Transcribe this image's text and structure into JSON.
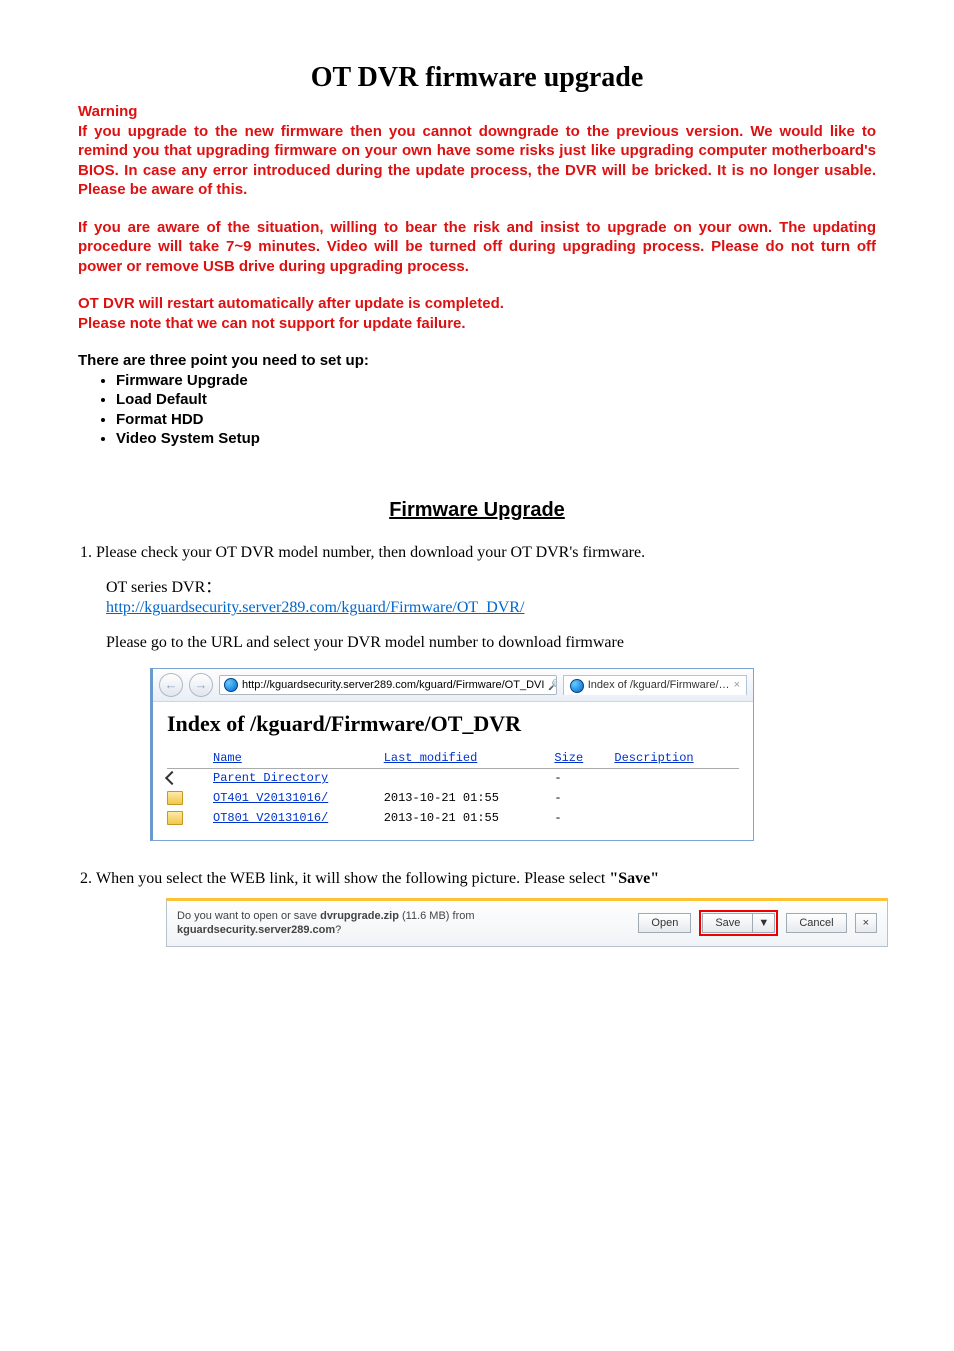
{
  "doc": {
    "title": "OT DVR firmware upgrade",
    "warning_label": "Warning",
    "warn_p1": "If you upgrade to the new firmware then you cannot downgrade to the previous version. We would like to remind you that upgrading firmware on your own have some risks just like upgrading computer motherboard's BIOS. In case any error introduced during the update process, the DVR will be bricked. It is no longer usable. Please be aware of this.",
    "warn_p2": "If you are aware of the situation, willing to bear the risk and insist to upgrade on your own. The updating procedure will take 7~9 minutes. Video will be turned off during upgrading process. Please do not turn off power or remove USB drive during upgrading process.",
    "warn_p3a": "OT DVR will restart automatically after update is completed.",
    "warn_p3b": "Please note that we can not support for update failure.",
    "setup_head": "There are three point you need to set up:",
    "setup_items": [
      "Firmware Upgrade",
      "Load Default",
      "Format HDD",
      "Video System Setup"
    ],
    "section_heading": "Firmware Upgrade",
    "step1": "Please check your OT DVR model number, then download your OT DVR's firmware.",
    "step1_label": "OT series DVR：",
    "step1_url": "http://kguardsecurity.server289.com/kguard/Firmware/OT_DVR/",
    "step1_note": "Please go to the URL and select your DVR model number to download firmware",
    "step2_pre": "When you select the WEB link, it will show the following picture. Please select ",
    "step2_bold": "\"Save\""
  },
  "browser": {
    "address": "http://kguardsecurity.server289.com/kguard/Firmware/OT_DVI",
    "search_glyph": "🔎",
    "tab_title": "Index of /kguard/Firmware/…",
    "page_heading": "Index of /kguard/Firmware/OT_DVR",
    "cols": {
      "name": "Name",
      "modified": "Last modified",
      "size": "Size",
      "desc": "Description"
    },
    "rows": [
      {
        "icon": "up",
        "name": "Parent Directory",
        "modified": "",
        "size": "-",
        "desc": ""
      },
      {
        "icon": "fold",
        "name": "OT401 V20131016/",
        "modified": "2013-10-21 01:55",
        "size": "-",
        "desc": ""
      },
      {
        "icon": "fold",
        "name": "OT801 V20131016/",
        "modified": "2013-10-21 01:55",
        "size": "-",
        "desc": ""
      }
    ]
  },
  "download": {
    "msg_pre": "Do you want to open or save ",
    "file": "dvrupgrade.zip",
    "size": " (11.6 MB) from ",
    "host": "kguardsecurity.server289.com",
    "q": "?",
    "open": "Open",
    "save": "Save",
    "caret": "▼",
    "cancel": "Cancel",
    "close": "×"
  }
}
